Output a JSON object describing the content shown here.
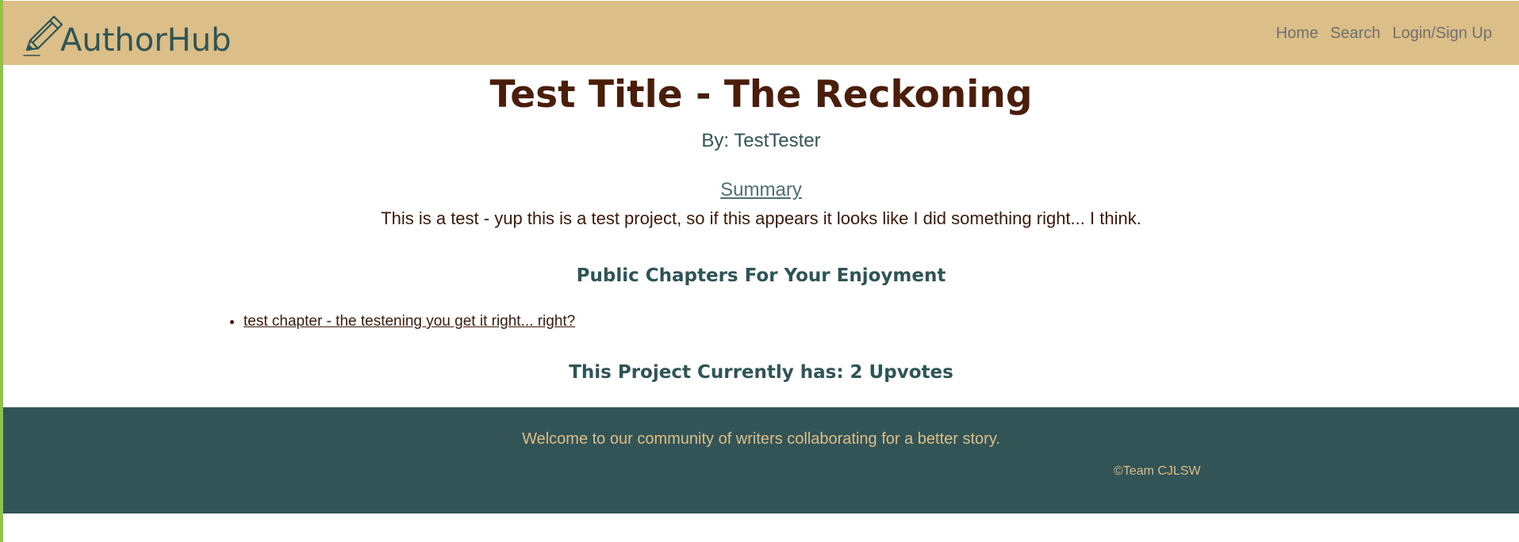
{
  "brand": {
    "name": "AuthorHub",
    "icon": "pencil-icon"
  },
  "nav": {
    "items": [
      {
        "label": "Home"
      },
      {
        "label": "Search"
      },
      {
        "label": "Login/Sign Up"
      }
    ]
  },
  "project": {
    "title": "Test Title - The Reckoning",
    "byline": "By: TestTester",
    "summary_heading": "Summary",
    "summary_text": "This is a test - yup this is a test project, so if this appears it looks like I did something right... I think.",
    "chapters_heading": "Public Chapters For Your Enjoyment",
    "chapters": [
      {
        "label": "test chapter - the testening you get it right... right?"
      }
    ],
    "upvotes_text": "This Project Currently has: 2 Upvotes"
  },
  "footer": {
    "text": "Welcome to our community of writers collaborating for a better story.",
    "copyright": "©Team CJLSW"
  },
  "colors": {
    "navbar": "#dcbf88",
    "footer": "#325456",
    "title": "#4a1e0a",
    "heading": "#2f5455",
    "accent_border": "#8ec63f"
  }
}
